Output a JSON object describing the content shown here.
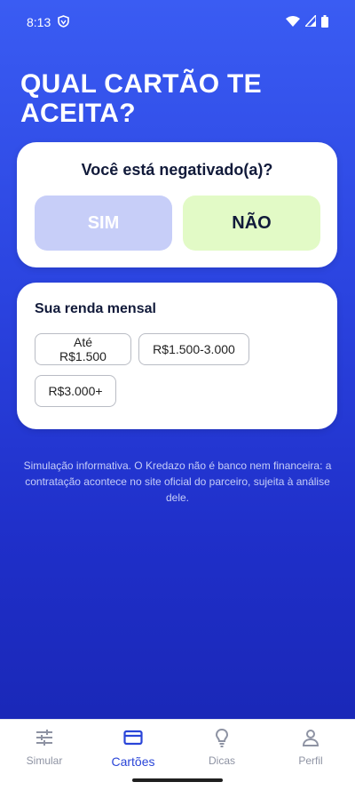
{
  "status_bar": {
    "time": "8:13"
  },
  "page": {
    "title": "QUAL CARTÃO TE ACEITA?"
  },
  "negativado_card": {
    "question": "Você está negativado(a)?",
    "option_yes": "SIM",
    "option_no": "NÃO"
  },
  "income_card": {
    "title": "Sua renda mensal",
    "options": [
      "Até R$1.500",
      "R$1.500-3.000",
      "R$3.000+"
    ]
  },
  "disclaimer": "Simulação informativa. O Kredazo não é banco nem financeira: a contratação acontece no site oficial do parceiro, sujeita à análise dele.",
  "bottom_nav": {
    "items": [
      {
        "label": "Simular",
        "icon": "sliders-icon"
      },
      {
        "label": "Cartões",
        "icon": "credit-card-icon"
      },
      {
        "label": "Dicas",
        "icon": "lightbulb-icon"
      },
      {
        "label": "Perfil",
        "icon": "person-icon"
      }
    ],
    "active": "Cartões"
  },
  "colors": {
    "primary_blue": "#2b44e0",
    "active_nav": "#2a45d8",
    "sim_bg": "#c7cef8",
    "nao_bg": "#e2fac6",
    "dark_text": "#111a3a"
  }
}
